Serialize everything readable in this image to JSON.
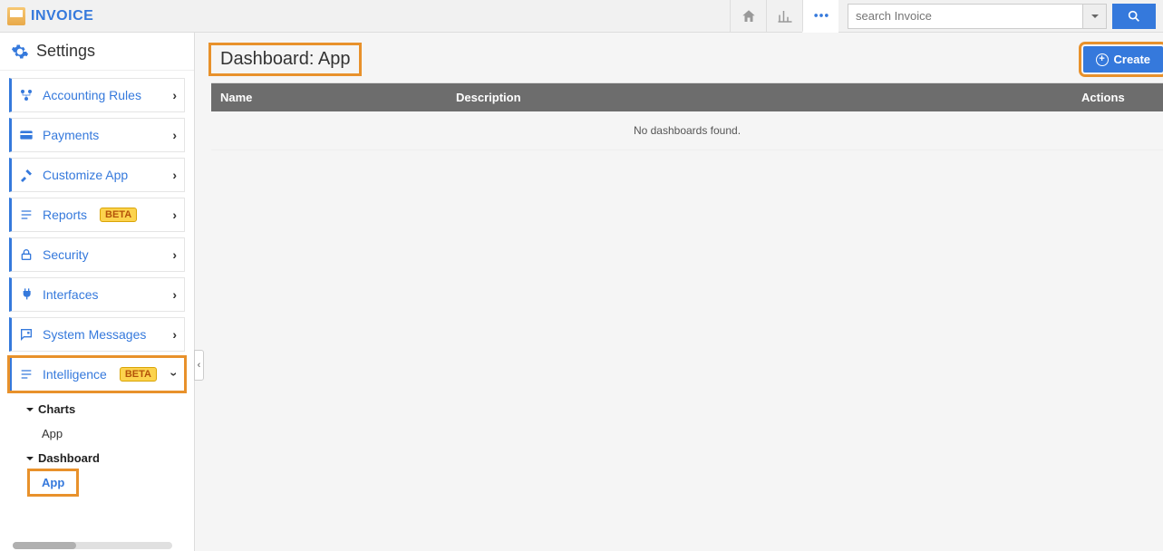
{
  "brand": "INVOICE",
  "search": {
    "placeholder": "search Invoice"
  },
  "sidebar": {
    "title": "Settings",
    "items": [
      {
        "label": "Accounting Rules",
        "icon": "process-icon"
      },
      {
        "label": "Payments",
        "icon": "card-icon"
      },
      {
        "label": "Customize App",
        "icon": "tools-icon"
      },
      {
        "label": "Reports",
        "icon": "list-icon",
        "badge": "BETA"
      },
      {
        "label": "Security",
        "icon": "lock-icon"
      },
      {
        "label": "Interfaces",
        "icon": "plug-icon"
      },
      {
        "label": "System Messages",
        "icon": "chat-icon"
      },
      {
        "label": "Intelligence",
        "icon": "list-icon",
        "badge": "BETA",
        "expanded": true
      }
    ],
    "sub": {
      "charts_label": "Charts",
      "charts_leaf": "App",
      "dashboard_label": "Dashboard",
      "dashboard_leaf": "App"
    }
  },
  "page": {
    "title": "Dashboard: App",
    "create_label": "Create",
    "columns": {
      "name": "Name",
      "desc": "Description",
      "actions": "Actions"
    },
    "empty": "No dashboards found."
  }
}
